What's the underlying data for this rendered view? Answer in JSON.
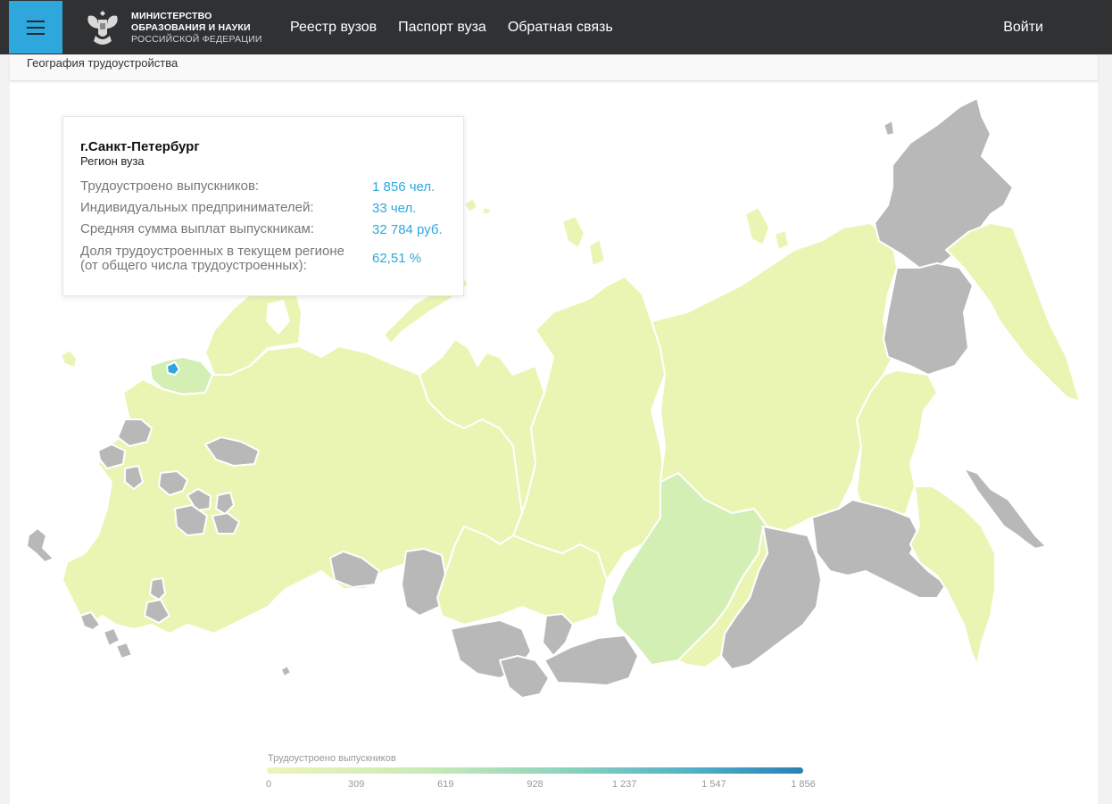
{
  "header": {
    "ministry_line1": "МИНИСТЕРСТВО",
    "ministry_line2": "ОБРАЗОВАНИЯ И НАУКИ",
    "ministry_line3": "РОССИЙСКОЙ ФЕДЕРАЦИИ",
    "nav": [
      "Реестр вузов",
      "Паспорт вуза",
      "Обратная связь"
    ],
    "login": "Войти"
  },
  "breadcrumb": "География трудоустройства",
  "tooltip": {
    "region": "г.Санкт-Петербург",
    "region_sub": "Регион вуза",
    "rows": [
      {
        "label": "Трудоустроено выпускников:",
        "value": "1 856 чел."
      },
      {
        "label": "Индивидуальных предпринимателей:",
        "value": "33 чел."
      },
      {
        "label": "Средняя сумма выплат выпускникам:",
        "value": "32 784 руб."
      },
      {
        "label": "Доля трудоустроенных в текущем регионе (от общего числа трудоустроенных):",
        "value": "62,51 %"
      }
    ]
  },
  "legend": {
    "title": "Трудоустроено выпускников",
    "ticks": [
      "0",
      "309",
      "619",
      "928",
      "1 237",
      "1 547",
      "1 856"
    ]
  },
  "colors": {
    "accent": "#2ea8dc",
    "header_bg": "#2f3133",
    "region_low": "#eaf5b4",
    "region_mid": "#d4efb4",
    "region_nodata": "#b8b8b8",
    "region_selected": "#2ea8dc",
    "border": "#ffffff"
  }
}
